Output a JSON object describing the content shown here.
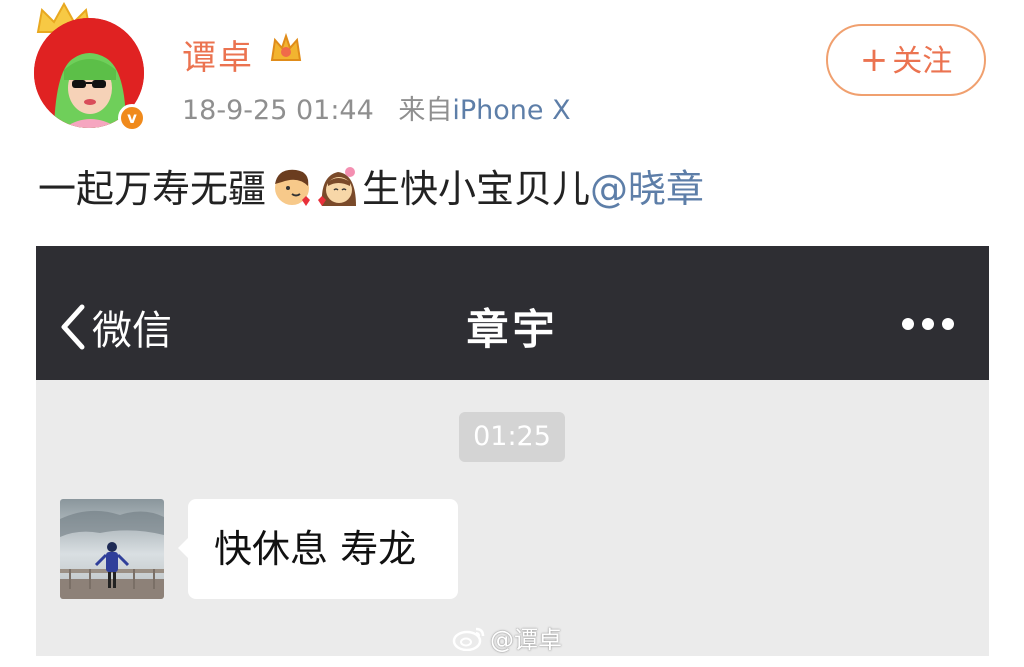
{
  "post": {
    "username": "谭卓",
    "time": "18-9-25 01:44",
    "source_prefix": "来自",
    "source_device": "iPhone X",
    "follow_plus": "+",
    "follow_label": "关注",
    "text_before": "一起万寿无疆",
    "text_after": "生快小宝贝儿",
    "mention": "@晓章",
    "emojis": [
      "couple-boy-emoji",
      "couple-girl-emoji"
    ]
  },
  "wechat": {
    "back_label": "微信",
    "title": "章宇",
    "timestamp": "01:25",
    "message": "快休息 寿龙",
    "nav_bg": "#2e2e33",
    "chat_bg": "#ebebeb"
  },
  "watermark": {
    "text": "@谭卓"
  },
  "colors": {
    "accent": "#eb7350",
    "link": "#5d7ea8",
    "meta": "#8f8f8f"
  }
}
